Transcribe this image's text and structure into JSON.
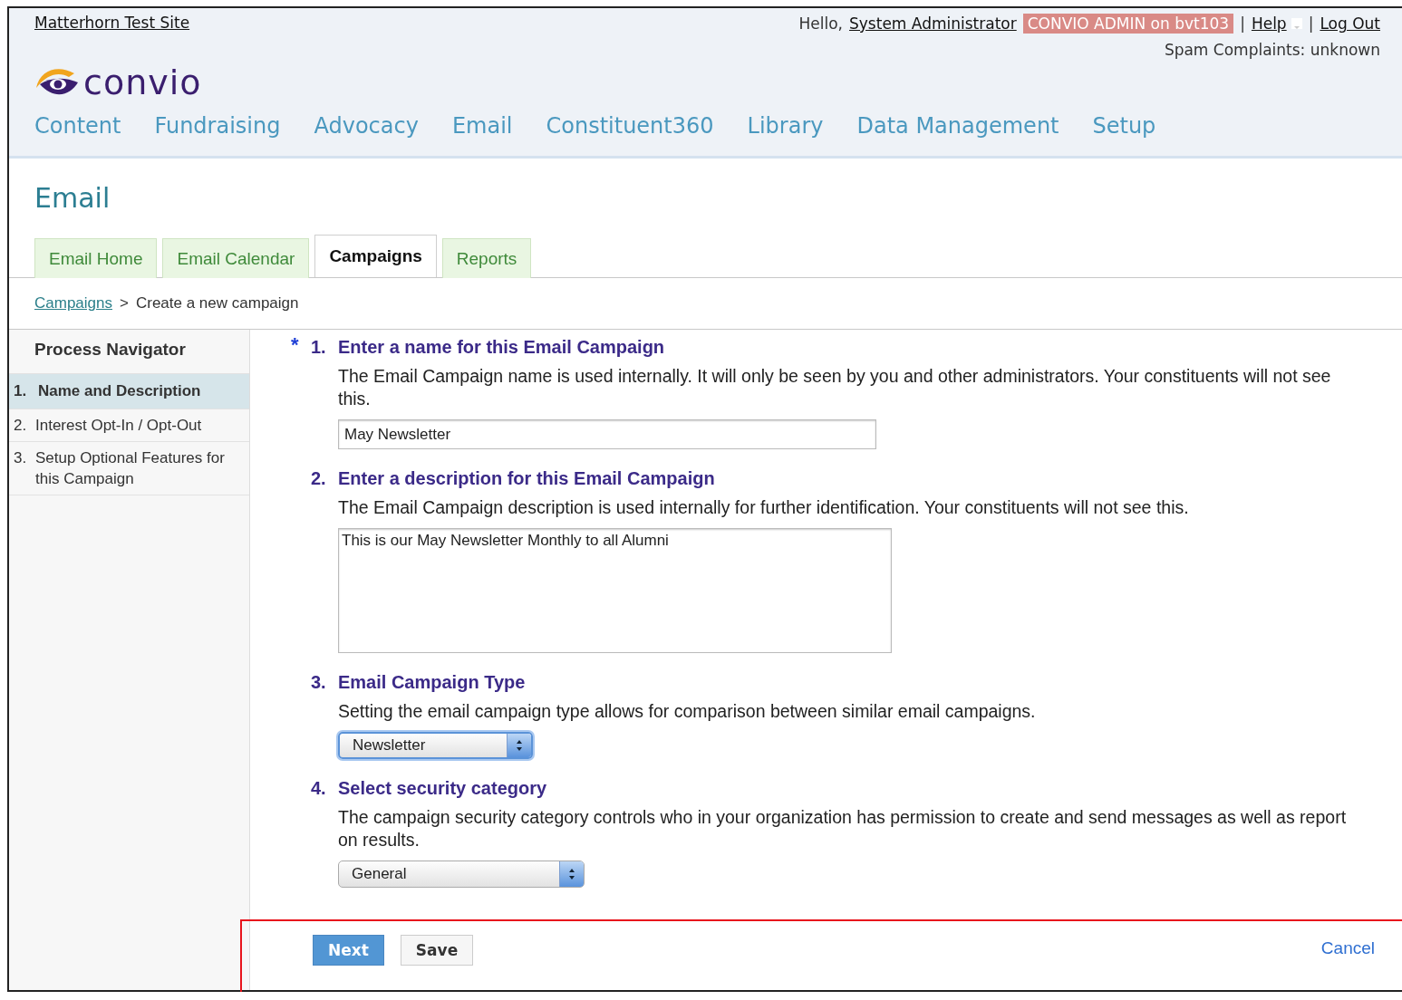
{
  "header": {
    "site_link": "Matterhorn Test Site",
    "greeting": "Hello,",
    "user_link": "System Administrator",
    "role_badge": "CONVIO ADMIN on bvt103",
    "separator_1": "|",
    "help_link": "Help",
    "separator_2": "|",
    "logout_link": "Log Out",
    "spam_status": "Spam Complaints: unknown",
    "logo_text": "convio"
  },
  "main_nav": [
    {
      "label": "Content"
    },
    {
      "label": "Fundraising"
    },
    {
      "label": "Advocacy"
    },
    {
      "label": "Email"
    },
    {
      "label": "Constituent360"
    },
    {
      "label": "Library"
    },
    {
      "label": "Data Management"
    },
    {
      "label": "Setup"
    }
  ],
  "page_title": "Email",
  "tabs": [
    {
      "label": "Email Home",
      "selected": false
    },
    {
      "label": "Email Calendar",
      "selected": false
    },
    {
      "label": "Campaigns",
      "selected": true
    },
    {
      "label": "Reports",
      "selected": false
    }
  ],
  "breadcrumb": {
    "link": "Campaigns",
    "separator": ">",
    "current": "Create a new campaign"
  },
  "process_navigator": {
    "title": "Process Navigator",
    "steps": [
      {
        "number": "1.",
        "label": "Name and Description",
        "selected": true
      },
      {
        "number": "2.",
        "label": "Interest Opt-In / Opt-Out",
        "selected": false
      },
      {
        "number": "3.",
        "label": "Setup Optional Features for this Campaign",
        "selected": false
      }
    ]
  },
  "steps": [
    {
      "kind": "text",
      "required_mark": "*",
      "number": "1.",
      "title": "Enter a name for this Email Campaign",
      "description": "The Email Campaign name is used internally. It will only be seen by you and other administrators. Your constituents will not see this.",
      "value": "May Newsletter"
    },
    {
      "kind": "textarea",
      "number": "2.",
      "title": "Enter a description for this Email Campaign",
      "description": "The Email Campaign description is used internally for further identification. Your constituents will not see this.",
      "value": "This is our May Newsletter Monthly to all Alumni"
    },
    {
      "kind": "select",
      "number": "3.",
      "title": "Email Campaign Type",
      "description": "Setting the email campaign type allows for comparison between similar email campaigns.",
      "value": "Newsletter",
      "focused": true
    },
    {
      "kind": "select",
      "number": "4.",
      "title": "Select security category",
      "description": "The campaign security category controls who in your organization has permission to create and send messages as well as report on results.",
      "value": "General",
      "focused": false
    }
  ],
  "buttons": [
    {
      "label": "Next",
      "primary": true
    },
    {
      "label": "Save",
      "primary": false
    }
  ],
  "cancel_link": "Cancel"
}
